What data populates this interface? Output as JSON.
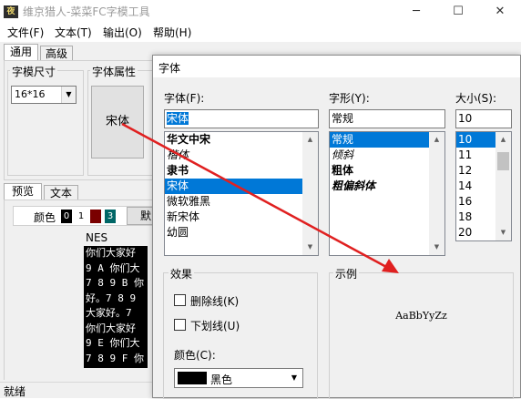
{
  "app": {
    "icon": "app-logo-icon",
    "title": "维京猎人-菜菜FC字模工具",
    "window_buttons": {
      "minimize": "─",
      "maximize": "☐",
      "close": "✕"
    }
  },
  "menu": [
    "文件(F)",
    "文本(T)",
    "输出(O)",
    "帮助(H)"
  ],
  "main_tabs": [
    "通用",
    "高级"
  ],
  "size_group": {
    "label": "字模尺寸",
    "value": "16*16"
  },
  "font_group": {
    "label": "字体属性",
    "button_text": "宋体"
  },
  "lower_tabs": [
    "预览",
    "文本"
  ],
  "color_row": {
    "label": "颜色",
    "swatches": [
      {
        "index": "0",
        "color": "#000000"
      },
      {
        "index": "1",
        "color": "#ffffff"
      },
      {
        "index": "",
        "color": "#7a0000"
      },
      {
        "index": "3",
        "color": "#006666"
      }
    ],
    "partial_button": "默"
  },
  "preview": {
    "label": "NES",
    "lines": [
      "你们大家好",
      "9 A 你们大",
      "7 8 9 B 你",
      "好。7 8 9",
      "大家好。7",
      "你们大家好",
      "9 E 你们大",
      "7 8 9 F 你"
    ]
  },
  "status": "就绪",
  "dialog": {
    "title": "字体",
    "font_label": "字体(F):",
    "font_value": "宋体",
    "fonts": [
      "华文中宋",
      "楷体",
      "隶书",
      "宋体",
      "微软雅黑",
      "新宋体",
      "幼圆"
    ],
    "font_selected_index": 3,
    "style_label": "字形(Y):",
    "style_value": "常规",
    "styles": [
      "常规",
      "倾斜",
      "粗体",
      "粗偏斜体"
    ],
    "style_selected_index": 0,
    "size_label": "大小(S):",
    "size_value": "10",
    "sizes": [
      "10",
      "11",
      "12",
      "14",
      "16",
      "18",
      "20"
    ],
    "size_selected_index": 0,
    "effects_label": "效果",
    "strikeout_label": "删除线(K)",
    "underline_label": "下划线(U)",
    "color_label": "颜色(C):",
    "color_value": "黑色",
    "color_swatch": "#000000",
    "sample_label": "示例",
    "sample_text": "AaBbYyZz"
  },
  "annotation_arrow_color": "#e02020"
}
